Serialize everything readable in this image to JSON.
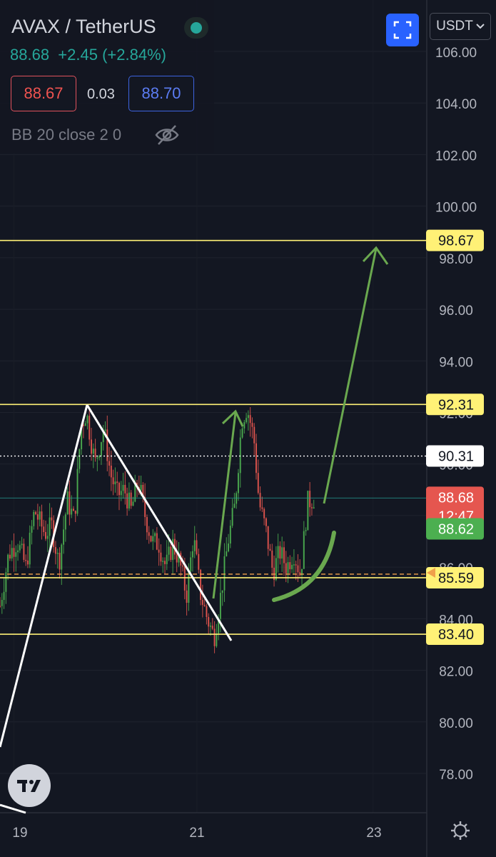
{
  "header": {
    "symbol": "AVAX / TetherUS",
    "last_price": "88.68",
    "change_text": "+2.45 (+2.84%)",
    "bid": "88.67",
    "spread": "0.03",
    "ask": "88.70",
    "indicator": "BB 20 close 2 0",
    "currency_button": "USDT",
    "live_status_icon": "live-dot-icon",
    "fullscreen_icon": "fullscreen-icon"
  },
  "colors": {
    "background": "#131722",
    "up": "#26a69a",
    "down": "#ef5350",
    "level_line": "#fff176",
    "arrow": "#6aa84f",
    "accent": "#2962ff"
  },
  "chart_data": {
    "type": "candlestick",
    "symbol": "AVAX / TetherUS",
    "quote_currency": "USDT",
    "y_ticks": [
      106.0,
      104.0,
      102.0,
      100.0,
      98.0,
      96.0,
      94.0,
      92.0,
      90.0,
      88.0,
      86.0,
      84.0,
      82.0,
      80.0,
      78.0
    ],
    "ylim": [
      76.7,
      107.0
    ],
    "x_ticks": [
      "19",
      "21",
      "23"
    ],
    "level_labels": [
      {
        "value": 98.67,
        "label": "98.67",
        "style": "yellow-line"
      },
      {
        "value": 92.31,
        "label": "92.31",
        "style": "yellow-line"
      },
      {
        "value": 90.31,
        "label": "90.31",
        "style": "white-dotted"
      },
      {
        "value": 88.68,
        "label": "88.68",
        "sub": "12:47",
        "style": "last-price"
      },
      {
        "value": 88.62,
        "label": "88.62",
        "style": "green-tag"
      },
      {
        "value": 85.59,
        "label": "85.59",
        "style": "yellow-line"
      },
      {
        "value": 83.4,
        "label": "83.40",
        "style": "yellow-line"
      }
    ],
    "price_path": [
      {
        "t": 0,
        "price": 84.5
      },
      {
        "t": 0.5,
        "price": 86.5
      },
      {
        "t": 1.0,
        "price": 87.0
      },
      {
        "t": 1.5,
        "price": 86.0
      },
      {
        "t": 2.0,
        "price": 88.2
      },
      {
        "t": 2.6,
        "price": 87.3
      },
      {
        "t": 3.0,
        "price": 87.6
      },
      {
        "t": 3.4,
        "price": 86.1
      },
      {
        "t": 3.9,
        "price": 88.6
      },
      {
        "t": 4.3,
        "price": 87.8
      },
      {
        "t": 4.7,
        "price": 91.5
      },
      {
        "t": 5.0,
        "price": 92.0
      },
      {
        "t": 5.5,
        "price": 90.0
      },
      {
        "t": 6.0,
        "price": 91.4
      },
      {
        "t": 6.4,
        "price": 89.6
      },
      {
        "t": 6.8,
        "price": 88.8
      },
      {
        "t": 7.2,
        "price": 89.0
      },
      {
        "t": 7.6,
        "price": 88.2
      },
      {
        "t": 8.0,
        "price": 89.4
      },
      {
        "t": 8.4,
        "price": 88.0
      },
      {
        "t": 8.8,
        "price": 87.0
      },
      {
        "t": 9.2,
        "price": 86.9
      },
      {
        "t": 9.6,
        "price": 86.0
      },
      {
        "t": 10.0,
        "price": 86.9
      },
      {
        "t": 10.4,
        "price": 86.2
      },
      {
        "t": 10.8,
        "price": 84.9
      },
      {
        "t": 11.2,
        "price": 87.2
      },
      {
        "t": 11.6,
        "price": 85.0
      },
      {
        "t": 12.0,
        "price": 84.0
      },
      {
        "t": 12.4,
        "price": 83.3
      },
      {
        "t": 12.8,
        "price": 85.0
      },
      {
        "t": 13.2,
        "price": 87.0
      },
      {
        "t": 13.6,
        "price": 88.4
      },
      {
        "t": 14.0,
        "price": 91.7
      },
      {
        "t": 14.3,
        "price": 92.2
      },
      {
        "t": 14.7,
        "price": 91.0
      },
      {
        "t": 15.0,
        "price": 88.5
      },
      {
        "t": 15.4,
        "price": 87.4
      },
      {
        "t": 15.8,
        "price": 85.8
      },
      {
        "t": 16.2,
        "price": 86.6
      },
      {
        "t": 16.6,
        "price": 86.0
      },
      {
        "t": 17.0,
        "price": 86.6
      },
      {
        "t": 17.4,
        "price": 85.7
      },
      {
        "t": 17.8,
        "price": 88.5
      },
      {
        "t": 18.2,
        "price": 88.7
      }
    ]
  },
  "branding": {
    "logo": "TV"
  },
  "footer": {
    "settings_icon": "settings-gear-icon"
  }
}
